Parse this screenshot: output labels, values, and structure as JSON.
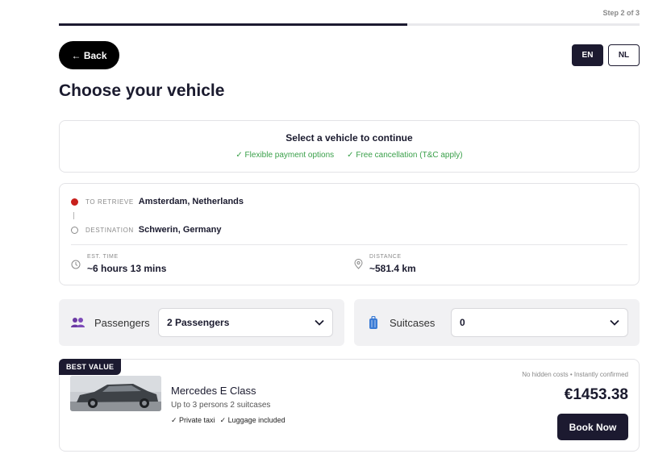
{
  "header": {
    "step_label": "Step 2 of 3",
    "progress_fraction": 0.6,
    "back_label": "← Back",
    "languages": [
      "EN",
      "NL"
    ],
    "active_language": "EN"
  },
  "page": {
    "title": "Choose your vehicle"
  },
  "select_card": {
    "title": "Select a vehicle to continue",
    "features": [
      "✓ Flexible payment options",
      "✓ Free cancellation (T&C apply)"
    ]
  },
  "route": {
    "pickup_label": "TO RETRIEVE",
    "pickup_city": "Amsterdam, Netherlands",
    "destination_label": "DESTINATION",
    "destination_city": "Schwerin, Germany",
    "time_label": "EST. TIME",
    "time_value": "~6 hours 13 mins",
    "distance_label": "DISTANCE",
    "distance_value": "~581.4 km"
  },
  "passengers": {
    "label": "Passengers",
    "value": "2 Passengers",
    "icon": "people-icon"
  },
  "suitcases": {
    "label": "Suitcases",
    "value": "0",
    "icon": "suitcase-icon"
  },
  "vehicle": {
    "badge": "BEST VALUE",
    "name": "Mercedes E Class",
    "capacity": "Up to 3 persons 2 suitcases",
    "features": [
      "✓ Private taxi",
      "✓ Luggage included"
    ],
    "note": "No hidden costs • Instantly confirmed",
    "price": "€1453.38",
    "book_label": "Book Now"
  },
  "colors": {
    "brand_dark": "#1c1a30",
    "green": "#3aa04a",
    "pickup_red": "#c8201c",
    "people_icon": "#6b3aa3",
    "suitcase_icon": "#3a7bd5"
  }
}
